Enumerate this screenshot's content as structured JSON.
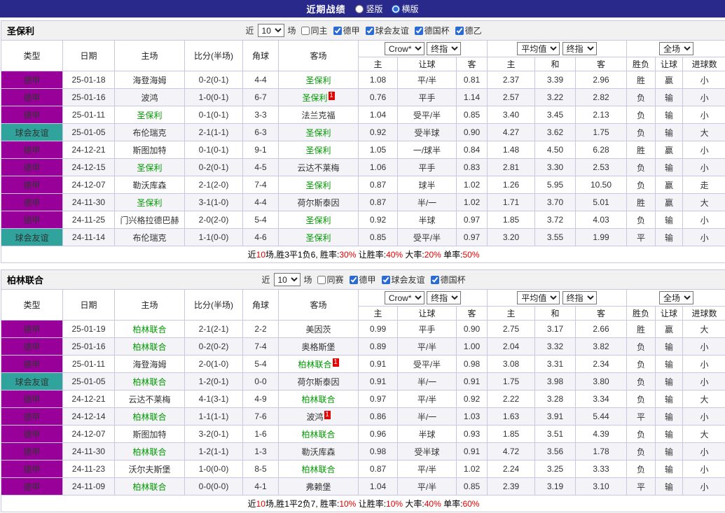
{
  "topbar": {
    "title": "近期战绩",
    "layout_options": [
      {
        "label": "竖版",
        "selected": false
      },
      {
        "label": "横版",
        "selected": true
      }
    ]
  },
  "columns": {
    "type": "类型",
    "date": "日期",
    "home": "主场",
    "score": "比分(半场)",
    "corner": "角球",
    "away": "客场",
    "odds_home": "主",
    "odds_handicap": "让球",
    "odds_away": "客",
    "avg_home": "主",
    "avg_draw": "和",
    "avg_away": "客",
    "result": "胜负",
    "handicap_result": "让球",
    "goals": "进球数"
  },
  "tables": [
    {
      "team": "圣保利",
      "filters": {
        "prefix": "近",
        "matches": "10",
        "suffix": "场",
        "options": [
          {
            "label": "同主",
            "checked": false
          },
          {
            "label": "德甲",
            "checked": true
          },
          {
            "label": "球会友谊",
            "checked": true
          },
          {
            "label": "德国杯",
            "checked": true
          },
          {
            "label": "德乙",
            "checked": true
          }
        ]
      },
      "selects": {
        "source": "Crow*",
        "source_time": "终指",
        "avg": "平均值",
        "avg_time": "终指",
        "scope": "全场"
      },
      "rows": [
        {
          "league": "德甲",
          "date": "25-01-18",
          "home": "海登海姆",
          "home_hl": false,
          "score": "0-2(0-1)",
          "corner": "4-4",
          "away": "圣保利",
          "away_hl": true,
          "o_home": "1.08",
          "o_let": "平/半",
          "o_away": "0.81",
          "a_home": "2.37",
          "a_draw": "3.39",
          "a_away": "2.96",
          "result": "胜",
          "let_result": "赢",
          "goal": "小"
        },
        {
          "league": "德甲",
          "date": "25-01-16",
          "home": "波鸿",
          "home_hl": false,
          "score": "1-0(0-1)",
          "corner": "6-7",
          "away": "圣保利",
          "away_hl": true,
          "away_card": "1",
          "o_home": "0.76",
          "o_let": "平手",
          "o_away": "1.14",
          "a_home": "2.57",
          "a_draw": "3.22",
          "a_away": "2.82",
          "result": "负",
          "let_result": "输",
          "goal": "小"
        },
        {
          "league": "德甲",
          "date": "25-01-11",
          "home": "圣保利",
          "home_hl": true,
          "score": "0-1(0-1)",
          "corner": "3-3",
          "away": "法兰克福",
          "away_hl": false,
          "o_home": "1.04",
          "o_let": "受平/半",
          "o_away": "0.85",
          "a_home": "3.40",
          "a_draw": "3.45",
          "a_away": "2.13",
          "result": "负",
          "let_result": "输",
          "goal": "小"
        },
        {
          "league": "球会友谊",
          "date": "25-01-05",
          "home": "布伦瑞克",
          "home_hl": false,
          "score": "2-1(1-1)",
          "corner": "6-3",
          "away": "圣保利",
          "away_hl": true,
          "o_home": "0.92",
          "o_let": "受半球",
          "o_away": "0.90",
          "a_home": "4.27",
          "a_draw": "3.62",
          "a_away": "1.75",
          "result": "负",
          "let_result": "输",
          "goal": "大"
        },
        {
          "league": "德甲",
          "date": "24-12-21",
          "home": "斯图加特",
          "home_hl": false,
          "score": "0-1(0-1)",
          "corner": "9-1",
          "away": "圣保利",
          "away_hl": true,
          "o_home": "1.05",
          "o_let": "一/球半",
          "o_away": "0.84",
          "a_home": "1.48",
          "a_draw": "4.50",
          "a_away": "6.28",
          "result": "胜",
          "let_result": "赢",
          "goal": "小"
        },
        {
          "league": "德甲",
          "date": "24-12-15",
          "home": "圣保利",
          "home_hl": true,
          "score": "0-2(0-1)",
          "corner": "4-5",
          "away": "云达不莱梅",
          "away_hl": false,
          "o_home": "1.06",
          "o_let": "平手",
          "o_away": "0.83",
          "a_home": "2.81",
          "a_draw": "3.30",
          "a_away": "2.53",
          "result": "负",
          "let_result": "输",
          "goal": "小"
        },
        {
          "league": "德甲",
          "date": "24-12-07",
          "home": "勒沃库森",
          "home_hl": false,
          "score": "2-1(2-0)",
          "corner": "7-4",
          "away": "圣保利",
          "away_hl": true,
          "o_home": "0.87",
          "o_let": "球半",
          "o_away": "1.02",
          "a_home": "1.26",
          "a_draw": "5.95",
          "a_away": "10.50",
          "result": "负",
          "let_result": "赢",
          "goal": "走"
        },
        {
          "league": "德甲",
          "date": "24-11-30",
          "home": "圣保利",
          "home_hl": true,
          "score": "3-1(1-0)",
          "corner": "4-4",
          "away": "荷尔斯泰因",
          "away_hl": false,
          "o_home": "0.87",
          "o_let": "半/一",
          "o_away": "1.02",
          "a_home": "1.71",
          "a_draw": "3.70",
          "a_away": "5.01",
          "result": "胜",
          "let_result": "赢",
          "goal": "大"
        },
        {
          "league": "德甲",
          "date": "24-11-25",
          "home": "门兴格拉德巴赫",
          "home_hl": false,
          "score": "2-0(2-0)",
          "corner": "5-4",
          "away": "圣保利",
          "away_hl": true,
          "o_home": "0.92",
          "o_let": "半球",
          "o_away": "0.97",
          "a_home": "1.85",
          "a_draw": "3.72",
          "a_away": "4.03",
          "result": "负",
          "let_result": "输",
          "goal": "小"
        },
        {
          "league": "球会友谊",
          "date": "24-11-14",
          "home": "布伦瑞克",
          "home_hl": false,
          "score": "1-1(0-0)",
          "corner": "4-6",
          "away": "圣保利",
          "away_hl": true,
          "o_home": "0.85",
          "o_let": "受平/半",
          "o_away": "0.97",
          "a_home": "3.20",
          "a_draw": "3.55",
          "a_away": "1.99",
          "result": "平",
          "let_result": "输",
          "goal": "小"
        }
      ],
      "summary": [
        {
          "text": "近",
          "red": false
        },
        {
          "text": "10",
          "red": true
        },
        {
          "text": "场,胜3平1负6, 胜率:",
          "red": false
        },
        {
          "text": "30%",
          "red": true
        },
        {
          "text": " 让胜率:",
          "red": false
        },
        {
          "text": "40%",
          "red": true
        },
        {
          "text": " 大率:",
          "red": false
        },
        {
          "text": "20%",
          "red": true
        },
        {
          "text": " 单率:",
          "red": false
        },
        {
          "text": "50%",
          "red": true
        }
      ]
    },
    {
      "team": "柏林联合",
      "filters": {
        "prefix": "近",
        "matches": "10",
        "suffix": "场",
        "options": [
          {
            "label": "同赛",
            "checked": false
          },
          {
            "label": "德甲",
            "checked": true
          },
          {
            "label": "球会友谊",
            "checked": true
          },
          {
            "label": "德国杯",
            "checked": true
          }
        ]
      },
      "selects": {
        "source": "Crow*",
        "source_time": "终指",
        "avg": "平均值",
        "avg_time": "终指",
        "scope": "全场"
      },
      "rows": [
        {
          "league": "德甲",
          "date": "25-01-19",
          "home": "柏林联合",
          "home_hl": true,
          "score": "2-1(2-1)",
          "corner": "2-2",
          "away": "美因茨",
          "away_hl": false,
          "o_home": "0.99",
          "o_let": "平手",
          "o_away": "0.90",
          "a_home": "2.75",
          "a_draw": "3.17",
          "a_away": "2.66",
          "result": "胜",
          "let_result": "赢",
          "goal": "大"
        },
        {
          "league": "德甲",
          "date": "25-01-16",
          "home": "柏林联合",
          "home_hl": true,
          "score": "0-2(0-2)",
          "corner": "7-4",
          "away": "奥格斯堡",
          "away_hl": false,
          "o_home": "0.89",
          "o_let": "平/半",
          "o_away": "1.00",
          "a_home": "2.04",
          "a_draw": "3.32",
          "a_away": "3.82",
          "result": "负",
          "let_result": "输",
          "goal": "小"
        },
        {
          "league": "德甲",
          "date": "25-01-11",
          "home": "海登海姆",
          "home_hl": false,
          "score": "2-0(1-0)",
          "corner": "5-4",
          "away": "柏林联合",
          "away_hl": true,
          "away_card": "1",
          "o_home": "0.91",
          "o_let": "受平/半",
          "o_away": "0.98",
          "a_home": "3.08",
          "a_draw": "3.31",
          "a_away": "2.34",
          "result": "负",
          "let_result": "输",
          "goal": "小"
        },
        {
          "league": "球会友谊",
          "date": "25-01-05",
          "home": "柏林联合",
          "home_hl": true,
          "score": "1-2(0-1)",
          "corner": "0-0",
          "away": "荷尔斯泰因",
          "away_hl": false,
          "o_home": "0.91",
          "o_let": "半/一",
          "o_away": "0.91",
          "a_home": "1.75",
          "a_draw": "3.98",
          "a_away": "3.80",
          "result": "负",
          "let_result": "输",
          "goal": "小"
        },
        {
          "league": "德甲",
          "date": "24-12-21",
          "home": "云达不莱梅",
          "home_hl": false,
          "score": "4-1(3-1)",
          "corner": "4-9",
          "away": "柏林联合",
          "away_hl": true,
          "o_home": "0.97",
          "o_let": "平/半",
          "o_away": "0.92",
          "a_home": "2.22",
          "a_draw": "3.28",
          "a_away": "3.34",
          "result": "负",
          "let_result": "输",
          "goal": "大"
        },
        {
          "league": "德甲",
          "date": "24-12-14",
          "home": "柏林联合",
          "home_hl": true,
          "score": "1-1(1-1)",
          "corner": "7-6",
          "away": "波鸿",
          "away_hl": false,
          "away_card": "1",
          "o_home": "0.86",
          "o_let": "半/一",
          "o_away": "1.03",
          "a_home": "1.63",
          "a_draw": "3.91",
          "a_away": "5.44",
          "result": "平",
          "let_result": "输",
          "goal": "小"
        },
        {
          "league": "德甲",
          "date": "24-12-07",
          "home": "斯图加特",
          "home_hl": false,
          "score": "3-2(0-1)",
          "corner": "1-6",
          "away": "柏林联合",
          "away_hl": true,
          "o_home": "0.96",
          "o_let": "半球",
          "o_away": "0.93",
          "a_home": "1.85",
          "a_draw": "3.51",
          "a_away": "4.39",
          "result": "负",
          "let_result": "输",
          "goal": "大"
        },
        {
          "league": "德甲",
          "date": "24-11-30",
          "home": "柏林联合",
          "home_hl": true,
          "score": "1-2(1-1)",
          "corner": "1-3",
          "away": "勒沃库森",
          "away_hl": false,
          "o_home": "0.98",
          "o_let": "受半球",
          "o_away": "0.91",
          "a_home": "4.72",
          "a_draw": "3.56",
          "a_away": "1.78",
          "result": "负",
          "let_result": "输",
          "goal": "小"
        },
        {
          "league": "德甲",
          "date": "24-11-23",
          "home": "沃尔夫斯堡",
          "home_hl": false,
          "score": "1-0(0-0)",
          "corner": "8-5",
          "away": "柏林联合",
          "away_hl": true,
          "o_home": "0.87",
          "o_let": "平/半",
          "o_away": "1.02",
          "a_home": "2.24",
          "a_draw": "3.25",
          "a_away": "3.33",
          "result": "负",
          "let_result": "输",
          "goal": "小"
        },
        {
          "league": "德甲",
          "date": "24-11-09",
          "home": "柏林联合",
          "home_hl": true,
          "score": "0-0(0-0)",
          "corner": "4-1",
          "away": "弗赖堡",
          "away_hl": false,
          "o_home": "1.04",
          "o_let": "平/半",
          "o_away": "0.85",
          "a_home": "2.39",
          "a_draw": "3.19",
          "a_away": "3.10",
          "result": "平",
          "let_result": "输",
          "goal": "小"
        }
      ],
      "summary": [
        {
          "text": "近",
          "red": false
        },
        {
          "text": "10",
          "red": true
        },
        {
          "text": "场,胜1平2负7, 胜率:",
          "red": false
        },
        {
          "text": "10%",
          "red": true
        },
        {
          "text": " 让胜率:",
          "red": false
        },
        {
          "text": "10%",
          "red": true
        },
        {
          "text": " 大率:",
          "red": false
        },
        {
          "text": "40%",
          "red": true
        },
        {
          "text": " 单率:",
          "red": false
        },
        {
          "text": "60%",
          "red": true
        }
      ]
    }
  ]
}
